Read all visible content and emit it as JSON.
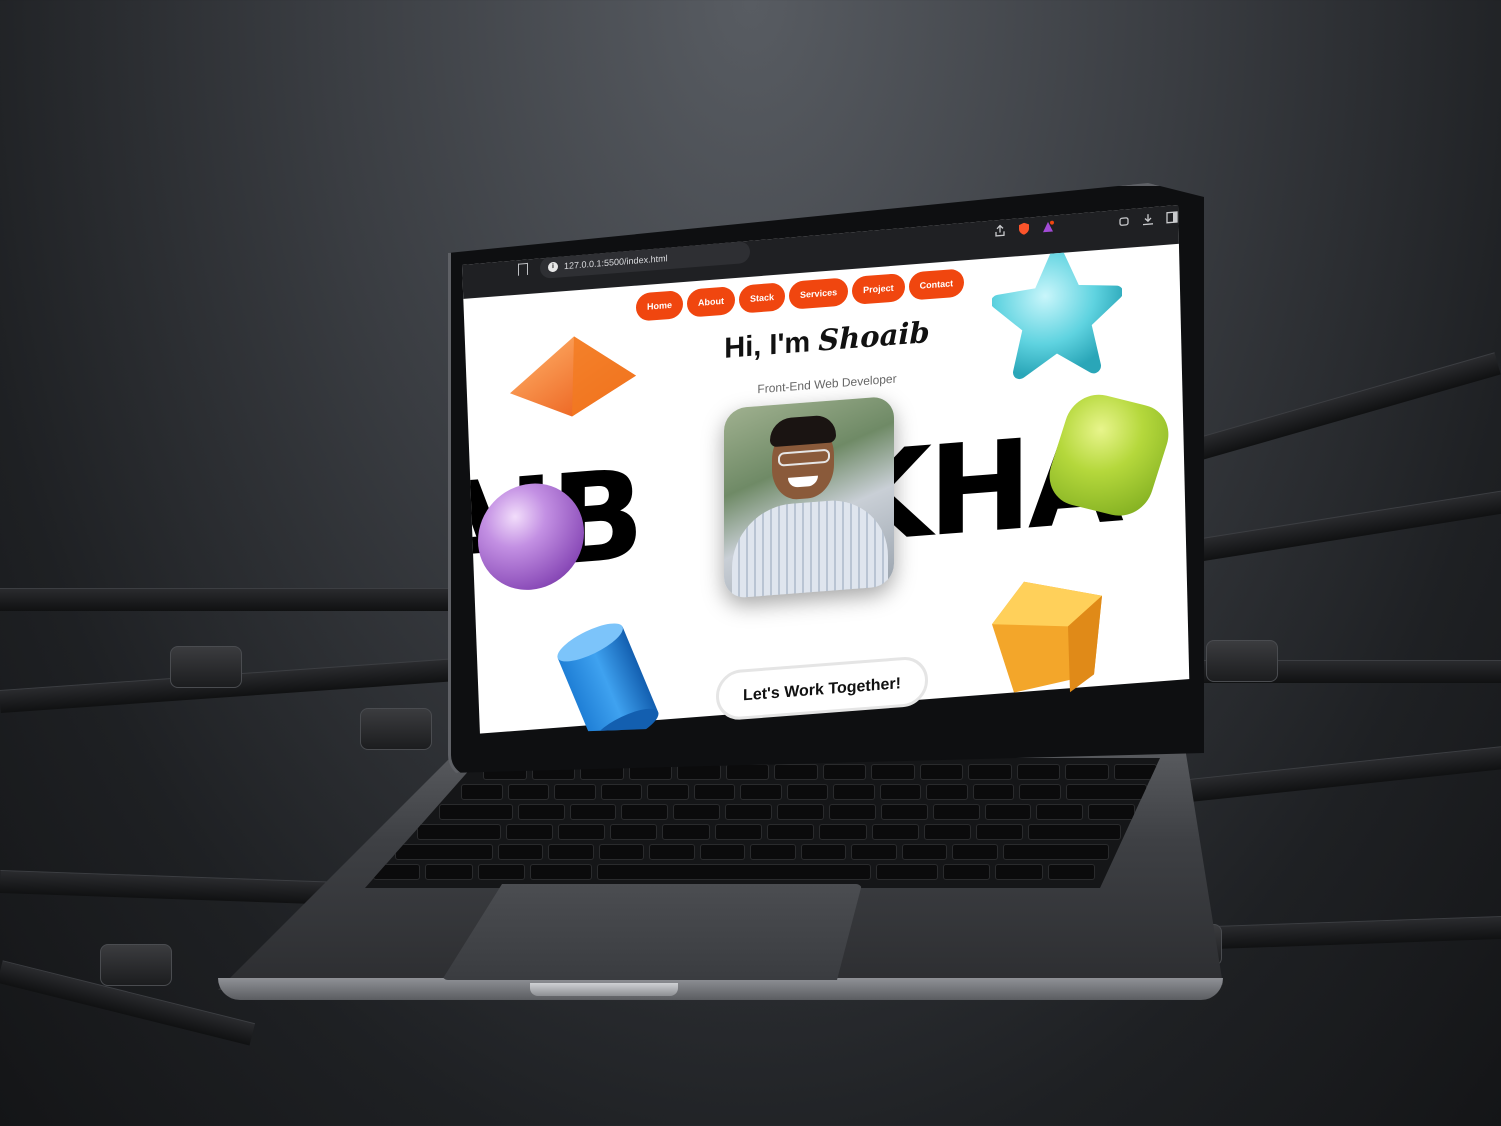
{
  "browser": {
    "url": "127.0.0.1:5500/index.html"
  },
  "nav": {
    "items": [
      "Home",
      "About",
      "Stack",
      "Services",
      "Project",
      "Contact"
    ]
  },
  "hero": {
    "greeting": "Hi, I'm",
    "name": "Shoaib",
    "subtitle": "Front-End Web Developer",
    "bigtext_left": "AIB",
    "bigtext_right": "KHA",
    "cta_label": "Let's Work Together!"
  },
  "colors": {
    "accent": "#f0460f",
    "background": "#ffffff",
    "text": "#111111"
  },
  "icons": [
    "bookmark-icon",
    "info-icon",
    "share-icon",
    "brave-shield-icon",
    "brave-rewards-icon",
    "extensions-icon",
    "download-icon",
    "sidebar-icon"
  ]
}
